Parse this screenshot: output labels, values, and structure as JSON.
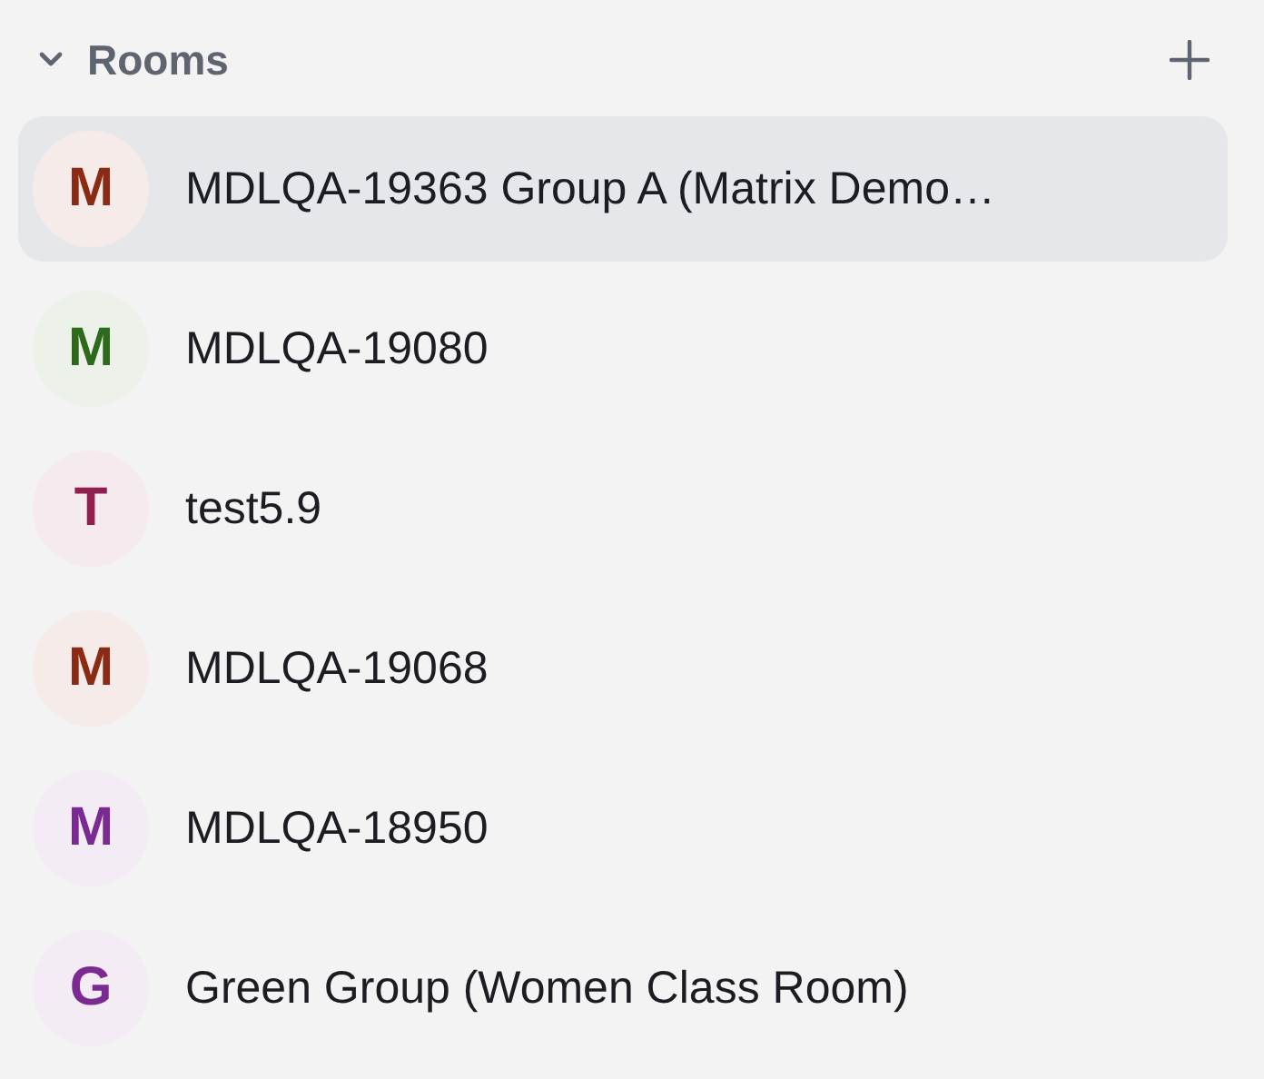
{
  "section": {
    "title": "Rooms",
    "expanded": true
  },
  "rooms": [
    {
      "avatar": "M",
      "name": "MDLQA-19363 Group A (Matrix Demo…",
      "color": "#8c2b13",
      "selected": true
    },
    {
      "avatar": "M",
      "name": "MDLQA-19080",
      "color": "#2e6a1b",
      "selected": false
    },
    {
      "avatar": "T",
      "name": "test5.9",
      "color": "#8f1f4e",
      "selected": false
    },
    {
      "avatar": "M",
      "name": "MDLQA-19068",
      "color": "#8c2b13",
      "selected": false
    },
    {
      "avatar": "M",
      "name": "MDLQA-18950",
      "color": "#7a2a90",
      "selected": false
    },
    {
      "avatar": "G",
      "name": "Green Group (Women Class Room)",
      "color": "#7a2a90",
      "selected": false
    }
  ]
}
